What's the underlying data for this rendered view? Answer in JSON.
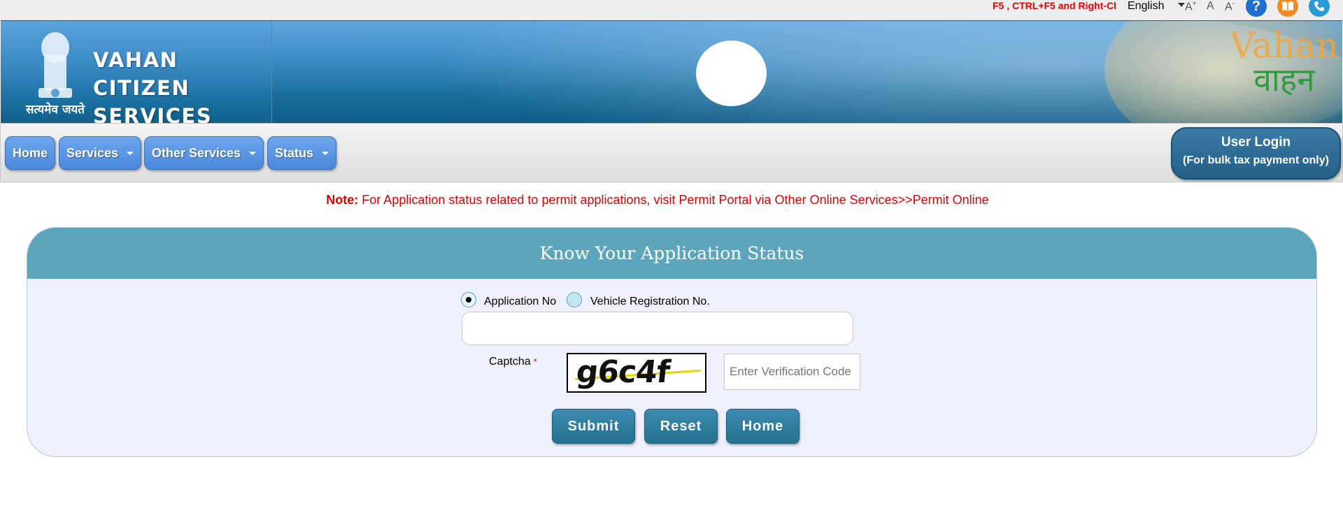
{
  "topbar": {
    "marquee": "F5 , CTRL+F5 and Right-Cl",
    "language": "English",
    "font_increase": "A",
    "font_increase_sign": "+",
    "font_normal": "A",
    "font_decrease": "A",
    "font_decrease_sign": "-",
    "icons": [
      "help-icon",
      "manual-icon",
      "phone-icon"
    ]
  },
  "header": {
    "title_line1": "VAHAN CITIZEN",
    "title_line2": "SERVICES",
    "emblem_motto": "सत्यमेव जयते",
    "logo_text_en": "Vahan",
    "logo_text_hi": "वाहन"
  },
  "nav": {
    "items": [
      {
        "label": "Home",
        "dropdown": false
      },
      {
        "label": "Services",
        "dropdown": true
      },
      {
        "label": "Other Services",
        "dropdown": true
      },
      {
        "label": "Status",
        "dropdown": true
      }
    ],
    "login_line1": "User Login",
    "login_line2": "(For bulk tax payment only)"
  },
  "note": {
    "prefix": "Note:",
    "text": " For Application status related to permit applications, visit Permit Portal via Other Online Services>>Permit Online"
  },
  "form": {
    "heading": "Know Your Application Status",
    "radio_application": "Application No",
    "radio_vehicle": "Vehicle Registration No.",
    "selected": "Application No",
    "application_value": "",
    "captcha_label": "Captcha",
    "captcha_required": "*",
    "captcha_text": "g6c4f",
    "verification_placeholder": "Enter Verification Code",
    "submit": "Submit",
    "reset": "Reset",
    "home": "Home"
  },
  "colors": {
    "nav_button": "#4a88dc",
    "login_button": "#2b6a92",
    "panel_header": "#5ba6bc",
    "panel_body": "#eef0fc",
    "action_button": "#2c7c9e",
    "note_text": "#e00000"
  }
}
